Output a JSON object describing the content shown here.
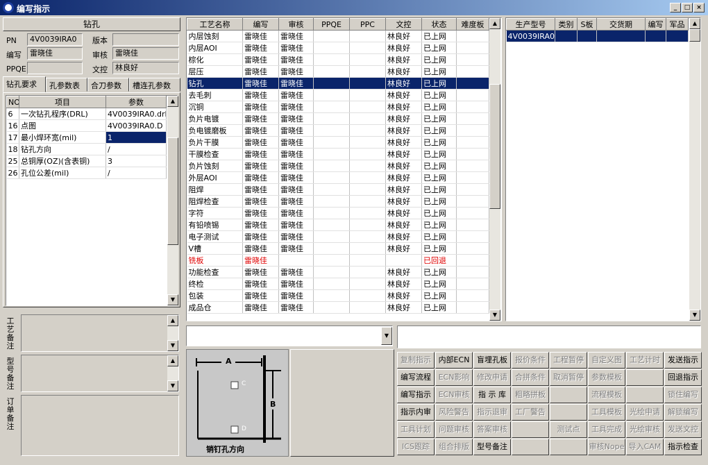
{
  "window": {
    "title": "编写指示",
    "min": "_",
    "max": "□",
    "close": "×"
  },
  "drill_panel": {
    "header": "钻孔",
    "pn_label": "PN",
    "pn_value": "4V0039IRA0",
    "version_label": "版本",
    "version_value": "",
    "author_label": "编写",
    "author_value": "雷晓佳",
    "review_label": "审核",
    "review_value": "雷晓佳",
    "ppqe_label": "PPQE",
    "ppqe_value": "",
    "doc_label": "文控",
    "doc_value": "林良好",
    "tabs": [
      "钻孔要求",
      "孔参数表",
      "合刀参数",
      "槽连孔参数"
    ],
    "table_headers": [
      "NO",
      "项目",
      "参数"
    ],
    "rows": [
      {
        "no": "6",
        "item": "一次钻孔程序(DRL)",
        "param": "4V0039IRA0.drl"
      },
      {
        "no": "16",
        "item": "点图",
        "param": "4V0039IRA0.D"
      },
      {
        "no": "17",
        "item": "最小焊环宽(mil)",
        "param": "1"
      },
      {
        "no": "18",
        "item": "钻孔方向",
        "param": "/"
      },
      {
        "no": "25",
        "item": "总铜厚(OZ)(含表铜)",
        "param": "3"
      },
      {
        "no": "26",
        "item": "孔位公差(mil)",
        "param": "/"
      }
    ],
    "notes": [
      {
        "label": "工艺备注"
      },
      {
        "label": "型号备注"
      },
      {
        "label": "订单备注"
      }
    ]
  },
  "process_table": {
    "headers": [
      "工艺名称",
      "编写",
      "审核",
      "PPQE",
      "PPC",
      "文控",
      "状态",
      "难度板"
    ],
    "rows": [
      [
        "内层蚀刻",
        "雷晓佳",
        "雷晓佳",
        "",
        "",
        "林良好",
        "已上网",
        ""
      ],
      [
        "内层AOI",
        "雷晓佳",
        "雷晓佳",
        "",
        "",
        "林良好",
        "已上网",
        ""
      ],
      [
        "棕化",
        "雷晓佳",
        "雷晓佳",
        "",
        "",
        "林良好",
        "已上网",
        ""
      ],
      [
        "层压",
        "雷晓佳",
        "雷晓佳",
        "",
        "",
        "林良好",
        "已上网",
        ""
      ],
      [
        "钻孔",
        "雷晓佳",
        "雷晓佳",
        "",
        "",
        "林良好",
        "已上网",
        ""
      ],
      [
        "去毛刺",
        "雷晓佳",
        "雷晓佳",
        "",
        "",
        "林良好",
        "已上网",
        ""
      ],
      [
        "沉铜",
        "雷晓佳",
        "雷晓佳",
        "",
        "",
        "林良好",
        "已上网",
        ""
      ],
      [
        "负片电镀",
        "雷晓佳",
        "雷晓佳",
        "",
        "",
        "林良好",
        "已上网",
        ""
      ],
      [
        "负电镀磨板",
        "雷晓佳",
        "雷晓佳",
        "",
        "",
        "林良好",
        "已上网",
        ""
      ],
      [
        "负片干膜",
        "雷晓佳",
        "雷晓佳",
        "",
        "",
        "林良好",
        "已上网",
        ""
      ],
      [
        "干膜检查",
        "雷晓佳",
        "雷晓佳",
        "",
        "",
        "林良好",
        "已上网",
        ""
      ],
      [
        "负片蚀刻",
        "雷晓佳",
        "雷晓佳",
        "",
        "",
        "林良好",
        "已上网",
        ""
      ],
      [
        "外层AOI",
        "雷晓佳",
        "雷晓佳",
        "",
        "",
        "林良好",
        "已上网",
        ""
      ],
      [
        "阻焊",
        "雷晓佳",
        "雷晓佳",
        "",
        "",
        "林良好",
        "已上网",
        ""
      ],
      [
        "阻焊检查",
        "雷晓佳",
        "雷晓佳",
        "",
        "",
        "林良好",
        "已上网",
        ""
      ],
      [
        "字符",
        "雷晓佳",
        "雷晓佳",
        "",
        "",
        "林良好",
        "已上网",
        ""
      ],
      [
        "有铅喷锡",
        "雷晓佳",
        "雷晓佳",
        "",
        "",
        "林良好",
        "已上网",
        ""
      ],
      [
        "电子测试",
        "雷晓佳",
        "雷晓佳",
        "",
        "",
        "林良好",
        "已上网",
        ""
      ],
      [
        "V槽",
        "雷晓佳",
        "雷晓佳",
        "",
        "",
        "林良好",
        "已上网",
        ""
      ],
      [
        "铣板",
        "雷晓佳",
        "",
        "",
        "",
        "",
        "已回退",
        ""
      ],
      [
        "功能检查",
        "雷晓佳",
        "雷晓佳",
        "",
        "",
        "林良好",
        "已上网",
        ""
      ],
      [
        "终检",
        "雷晓佳",
        "雷晓佳",
        "",
        "",
        "林良好",
        "已上网",
        ""
      ],
      [
        "包装",
        "雷晓佳",
        "雷晓佳",
        "",
        "",
        "林良好",
        "已上网",
        ""
      ],
      [
        "成品仓",
        "雷晓佳",
        "雷晓佳",
        "",
        "",
        "林良好",
        "已上网",
        ""
      ]
    ]
  },
  "order_table": {
    "headers": [
      "生产型号",
      "类别",
      "S板",
      "交货期",
      "编写",
      "军品"
    ],
    "rows": [
      [
        "4V0039IRA0",
        "",
        "",
        "",
        "",
        ""
      ]
    ]
  },
  "diagram": {
    "label_a": "A",
    "label_b": "B",
    "label_c": "C",
    "label_d": "D",
    "caption": "销钉孔方向"
  },
  "buttons": [
    [
      "复制指示",
      "内部ECN",
      "盲埋孔板",
      "报价条件",
      "工程暂停",
      "自定义图",
      "工艺计时",
      "发送指示"
    ],
    [
      "编写流程",
      "ECN影响",
      "修改申请",
      "合拼条件",
      "取消暂停",
      "参数模板",
      "",
      "回退指示"
    ],
    [
      "编写指示",
      "ECN审核",
      "指 示 库",
      "粗略拼板",
      "",
      "流程模板",
      "",
      "锁住编写"
    ],
    [
      "指示内审",
      "风险警告",
      "指示退审",
      "工厂警告",
      "",
      "工具模板",
      "光绘申请",
      "解锁编写"
    ],
    [
      "工具计划",
      "问题审核",
      "答案审核",
      "",
      "测试点",
      "工具完成",
      "光绘审核",
      "发送文控"
    ],
    [
      "ICS跟踪",
      "组合排版",
      "型号备注",
      "",
      "",
      "审核Nope",
      "导入CAM",
      "指示检查"
    ]
  ],
  "buttons_enabled": [
    [
      false,
      true,
      true,
      false,
      false,
      false,
      false,
      true
    ],
    [
      true,
      false,
      false,
      false,
      false,
      false,
      false,
      true
    ],
    [
      true,
      false,
      true,
      false,
      false,
      false,
      false,
      false
    ],
    [
      true,
      false,
      false,
      false,
      false,
      false,
      false,
      false
    ],
    [
      false,
      false,
      false,
      false,
      false,
      false,
      false,
      false
    ],
    [
      false,
      false,
      true,
      false,
      false,
      false,
      false,
      true
    ]
  ]
}
